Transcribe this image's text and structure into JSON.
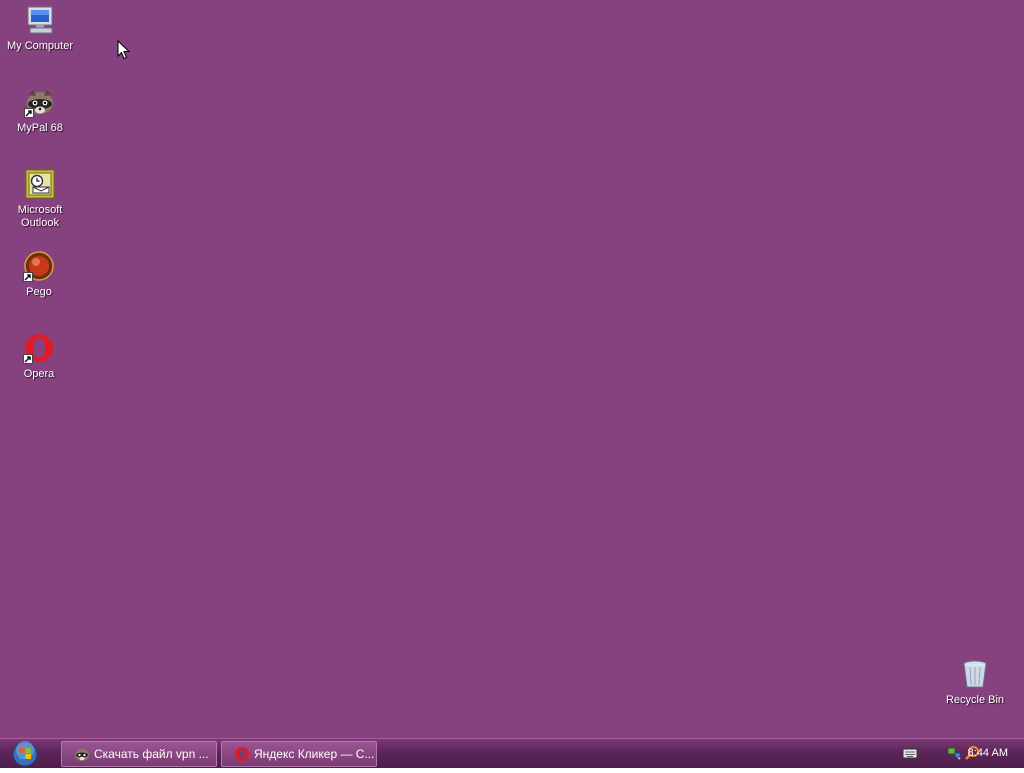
{
  "desktop": {
    "background_color": "#86427e",
    "icons": [
      {
        "label": "My Computer",
        "icon": "my-computer-icon"
      },
      {
        "label": "MyPal 68",
        "icon": "mypal-raccoon-icon"
      },
      {
        "label": "Microsoft Outlook",
        "icon": "outlook-icon"
      },
      {
        "label": "Pego",
        "icon": "pego-icon"
      },
      {
        "label": "Opera",
        "icon": "opera-icon"
      },
      {
        "label": "Recycle Bin",
        "icon": "recycle-bin-icon"
      }
    ]
  },
  "taskbar": {
    "start_button": "windows-start-orb-icon",
    "tasks": [
      {
        "label": "Скачать файл vpn ...",
        "icon": "mypal-raccoon-icon"
      },
      {
        "label": "Яндекс Кликер — С...",
        "icon": "opera-icon"
      }
    ],
    "tray": {
      "icons": [
        "keyboard-icon",
        "network-icon",
        "search-icon"
      ],
      "clock": "8:44 AM"
    }
  }
}
